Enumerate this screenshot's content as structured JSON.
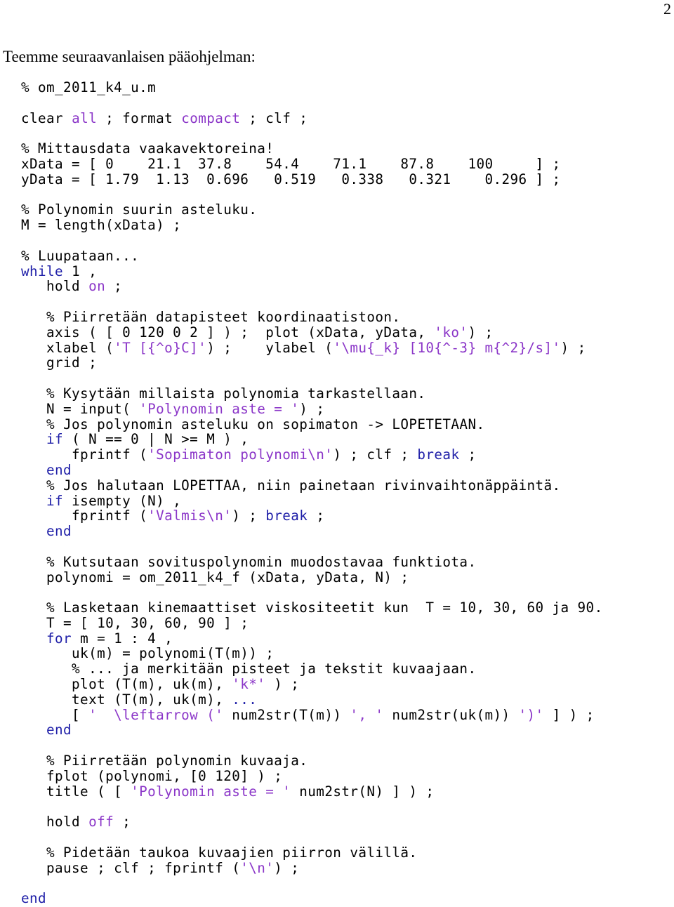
{
  "page_number": "2",
  "intro_text": "Teemme seuraavanlaisen pääohjelman:",
  "colors": {
    "keyword": "#1f1fa8",
    "string": "#8b36c8",
    "text": "#000000"
  },
  "code_lines": [
    [
      {
        "t": "% om_2011_k4_u.m"
      }
    ],
    [],
    [
      {
        "t": "clear "
      },
      {
        "t": "all",
        "c": "str"
      },
      {
        "t": " ; format "
      },
      {
        "t": "compact",
        "c": "str"
      },
      {
        "t": " ; clf ;"
      }
    ],
    [],
    [
      {
        "t": "% Mittausdata vaakavektoreina!"
      }
    ],
    [
      {
        "t": "xData = [ 0    21.1  37.8    54.4    71.1    87.8    100     ] ;"
      }
    ],
    [
      {
        "t": "yData = [ 1.79  1.13  0.696   0.519   0.338   0.321    0.296 ] ;"
      }
    ],
    [],
    [
      {
        "t": "% Polynomin suurin asteluku."
      }
    ],
    [
      {
        "t": "M = length(xData) ;"
      }
    ],
    [],
    [
      {
        "t": "% Luupataan..."
      }
    ],
    [
      {
        "t": "while",
        "c": "kw"
      },
      {
        "t": " 1 ,"
      }
    ],
    [
      {
        "t": "   hold "
      },
      {
        "t": "on",
        "c": "str"
      },
      {
        "t": " ;"
      }
    ],
    [],
    [
      {
        "t": "   % Piirretään datapisteet koordinaatistoon."
      }
    ],
    [
      {
        "t": "   axis ( [ 0 120 0 2 ] ) ;  plot (xData, yData, "
      },
      {
        "t": "'ko'",
        "c": "str"
      },
      {
        "t": ") ;"
      }
    ],
    [
      {
        "t": "   xlabel ("
      },
      {
        "t": "'T [{^o}C]'",
        "c": "str"
      },
      {
        "t": ") ;    ylabel ("
      },
      {
        "t": "'\\mu{_k} [10{^-3} m{^2}/s]'",
        "c": "str"
      },
      {
        "t": ") ;"
      }
    ],
    [
      {
        "t": "   grid ;"
      }
    ],
    [],
    [
      {
        "t": "   % Kysytään millaista polynomia tarkastellaan."
      }
    ],
    [
      {
        "t": "   N = input( "
      },
      {
        "t": "'Polynomin aste = '",
        "c": "str"
      },
      {
        "t": ") ;"
      }
    ],
    [
      {
        "t": "   % Jos polynomin asteluku on sopimaton -> LOPETETAAN."
      }
    ],
    [
      {
        "t": "   "
      },
      {
        "t": "if",
        "c": "kw"
      },
      {
        "t": " ( N == 0 | N >= M ) ,"
      }
    ],
    [
      {
        "t": "      fprintf ("
      },
      {
        "t": "'Sopimaton polynomi\\n'",
        "c": "str"
      },
      {
        "t": ") ; clf ; "
      },
      {
        "t": "break",
        "c": "kw"
      },
      {
        "t": " ;"
      }
    ],
    [
      {
        "t": "   "
      },
      {
        "t": "end",
        "c": "kw"
      }
    ],
    [
      {
        "t": "   % Jos halutaan LOPETTAA, niin painetaan rivinvaihtonäppäintä."
      }
    ],
    [
      {
        "t": "   "
      },
      {
        "t": "if",
        "c": "kw"
      },
      {
        "t": " isempty (N) ,"
      }
    ],
    [
      {
        "t": "      fprintf ("
      },
      {
        "t": "'Valmis\\n'",
        "c": "str"
      },
      {
        "t": ") ; "
      },
      {
        "t": "break",
        "c": "kw"
      },
      {
        "t": " ;"
      }
    ],
    [
      {
        "t": "   "
      },
      {
        "t": "end",
        "c": "kw"
      }
    ],
    [],
    [
      {
        "t": "   % Kutsutaan sovituspolynomin muodostavaa funktiota."
      }
    ],
    [
      {
        "t": "   polynomi = om_2011_k4_f (xData, yData, N) ;"
      }
    ],
    [],
    [
      {
        "t": "   % Lasketaan kinemaattiset viskositeetit kun  T = 10, 30, 60 ja 90."
      }
    ],
    [
      {
        "t": "   T = [ 10, 30, 60, 90 ] ;"
      }
    ],
    [
      {
        "t": "   "
      },
      {
        "t": "for",
        "c": "kw"
      },
      {
        "t": " m = 1 : 4 ,"
      }
    ],
    [
      {
        "t": "      uk(m) = polynomi(T(m)) ;"
      }
    ],
    [
      {
        "t": "      % ... ja merkitään pisteet ja tekstit kuvaajaan."
      }
    ],
    [
      {
        "t": "      plot (T(m), uk(m), "
      },
      {
        "t": "'k*'",
        "c": "str"
      },
      {
        "t": " ) ;"
      }
    ],
    [
      {
        "t": "      text (T(m), uk(m), "
      },
      {
        "t": "...",
        "c": "kw"
      }
    ],
    [
      {
        "t": "      [ "
      },
      {
        "t": "'  \\leftarrow ('",
        "c": "str"
      },
      {
        "t": " num2str(T(m)) "
      },
      {
        "t": "', '",
        "c": "str"
      },
      {
        "t": " num2str(uk(m)) "
      },
      {
        "t": "')'",
        "c": "str"
      },
      {
        "t": " ] ) ;"
      }
    ],
    [
      {
        "t": "   "
      },
      {
        "t": "end",
        "c": "kw"
      }
    ],
    [],
    [
      {
        "t": "   % Piirretään polynomin kuvaaja."
      }
    ],
    [
      {
        "t": "   fplot (polynomi, [0 120] ) ;"
      }
    ],
    [
      {
        "t": "   title ( [ "
      },
      {
        "t": "'Polynomin aste = '",
        "c": "str"
      },
      {
        "t": " num2str(N) ] ) ;"
      }
    ],
    [],
    [
      {
        "t": "   hold "
      },
      {
        "t": "off",
        "c": "str"
      },
      {
        "t": " ;"
      }
    ],
    [],
    [
      {
        "t": "   % Pidetään taukoa kuvaajien piirron välillä."
      }
    ],
    [
      {
        "t": "   pause ; clf ; fprintf ("
      },
      {
        "t": "'\\n'",
        "c": "str"
      },
      {
        "t": ") ;"
      }
    ],
    [],
    [
      {
        "t": "end",
        "c": "kw"
      }
    ]
  ]
}
